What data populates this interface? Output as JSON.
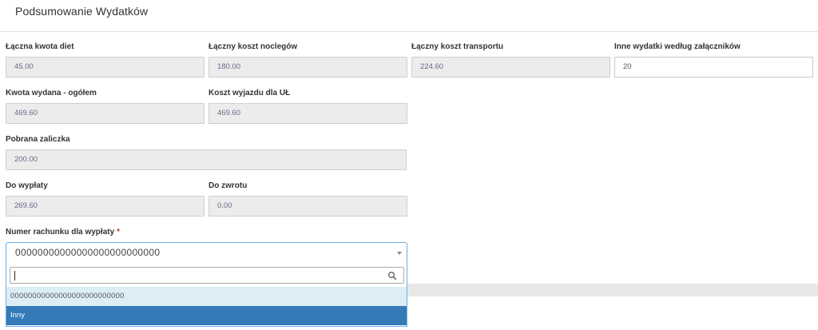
{
  "header": {
    "title": "Podsumowanie Wydatków"
  },
  "fields": {
    "diet": {
      "label": "Łączna kwota diet",
      "value": "45.00"
    },
    "nocleg": {
      "label": "Łączny koszt noclegów",
      "value": "180.00"
    },
    "transport": {
      "label": "Łączny koszt transportu",
      "value": "224.60"
    },
    "inne": {
      "label": "Inne wydatki według załączników",
      "value": "20"
    },
    "ogolem": {
      "label": "Kwota wydana - ogółem",
      "value": "469.60"
    },
    "wyjazd": {
      "label": "Koszt wyjazdu dla UŁ",
      "value": "469.60"
    },
    "zaliczka": {
      "label": "Pobrana zaliczka",
      "value": "200.00"
    },
    "wyplata": {
      "label": "Do wypłaty",
      "value": "269.60"
    },
    "zwrot": {
      "label": "Do zwrotu",
      "value": "0.00"
    }
  },
  "account": {
    "label": "Numer rachunku dla wypłaty",
    "required_mark": "*",
    "selected": "00000000000000000000000000",
    "search_value": "",
    "options": [
      {
        "label": "00000000000000000000000000"
      },
      {
        "label": "Inny"
      }
    ]
  }
}
